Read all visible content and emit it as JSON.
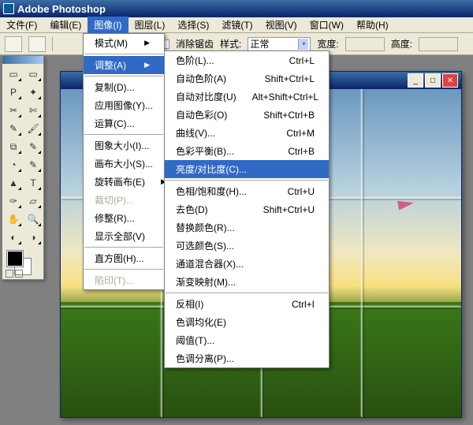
{
  "app": {
    "title": "Adobe Photoshop"
  },
  "menubar": {
    "items": [
      {
        "label": "文件(F)"
      },
      {
        "label": "编辑(E)"
      },
      {
        "label": "图像(I)"
      },
      {
        "label": "图层(L)"
      },
      {
        "label": "选择(S)"
      },
      {
        "label": "滤镜(T)"
      },
      {
        "label": "视图(V)"
      },
      {
        "label": "窗口(W)"
      },
      {
        "label": "帮助(H)"
      }
    ]
  },
  "options": {
    "clear_anchor": "消除锯齿",
    "style_label": "样式:",
    "style_value": "正常",
    "width_label": "宽度:",
    "height_label": "高度:"
  },
  "menu1": {
    "items": [
      {
        "label": "模式(M)",
        "sub": true
      },
      {
        "sep": true
      },
      {
        "label": "调整(A)",
        "sub": true,
        "hl": true
      },
      {
        "sep": true
      },
      {
        "label": "复制(D)..."
      },
      {
        "label": "应用图像(Y)..."
      },
      {
        "label": "运算(C)..."
      },
      {
        "sep": true
      },
      {
        "label": "图象大小(I)..."
      },
      {
        "label": "画布大小(S)..."
      },
      {
        "label": "旋转画布(E)",
        "sub": true
      },
      {
        "label": "裁切(P)...",
        "dis": true
      },
      {
        "label": "修整(R)..."
      },
      {
        "label": "显示全部(V)"
      },
      {
        "sep": true
      },
      {
        "label": "直方图(H)..."
      },
      {
        "sep": true
      },
      {
        "label": "陷印(T)...",
        "dis": true
      }
    ]
  },
  "menu2": {
    "items": [
      {
        "label": "色阶(L)...",
        "sc": "Ctrl+L"
      },
      {
        "label": "自动色阶(A)",
        "sc": "Shift+Ctrl+L"
      },
      {
        "label": "自动对比度(U)",
        "sc": "Alt+Shift+Ctrl+L"
      },
      {
        "label": "自动色彩(O)",
        "sc": "Shift+Ctrl+B"
      },
      {
        "label": "曲线(V)...",
        "sc": "Ctrl+M"
      },
      {
        "label": "色彩平衡(B)...",
        "sc": "Ctrl+B"
      },
      {
        "label": "亮度/对比度(C)...",
        "hl": true
      },
      {
        "sep": true
      },
      {
        "label": "色相/饱和度(H)...",
        "sc": "Ctrl+U"
      },
      {
        "label": "去色(D)",
        "sc": "Shift+Ctrl+U"
      },
      {
        "label": "替换颜色(R)..."
      },
      {
        "label": "可选颜色(S)..."
      },
      {
        "label": "通道混合器(X)..."
      },
      {
        "label": "渐变映射(M)..."
      },
      {
        "sep": true
      },
      {
        "label": "反相(I)",
        "sc": "Ctrl+I"
      },
      {
        "label": "色调均化(E)"
      },
      {
        "label": "阈值(T)..."
      },
      {
        "label": "色调分离(P)..."
      }
    ]
  },
  "toolbox": {
    "tools": [
      "▭",
      "▭",
      "P",
      "✦",
      "✂",
      "✄",
      "✎",
      "🖌",
      "⧉",
      "✎",
      "◔",
      "✎",
      "▲",
      "T",
      "✑",
      "▱",
      "✋",
      "🔍",
      "◐",
      "◑"
    ]
  },
  "docwin": {
    "minimize": "_",
    "maximize": "□",
    "close": "✕"
  }
}
